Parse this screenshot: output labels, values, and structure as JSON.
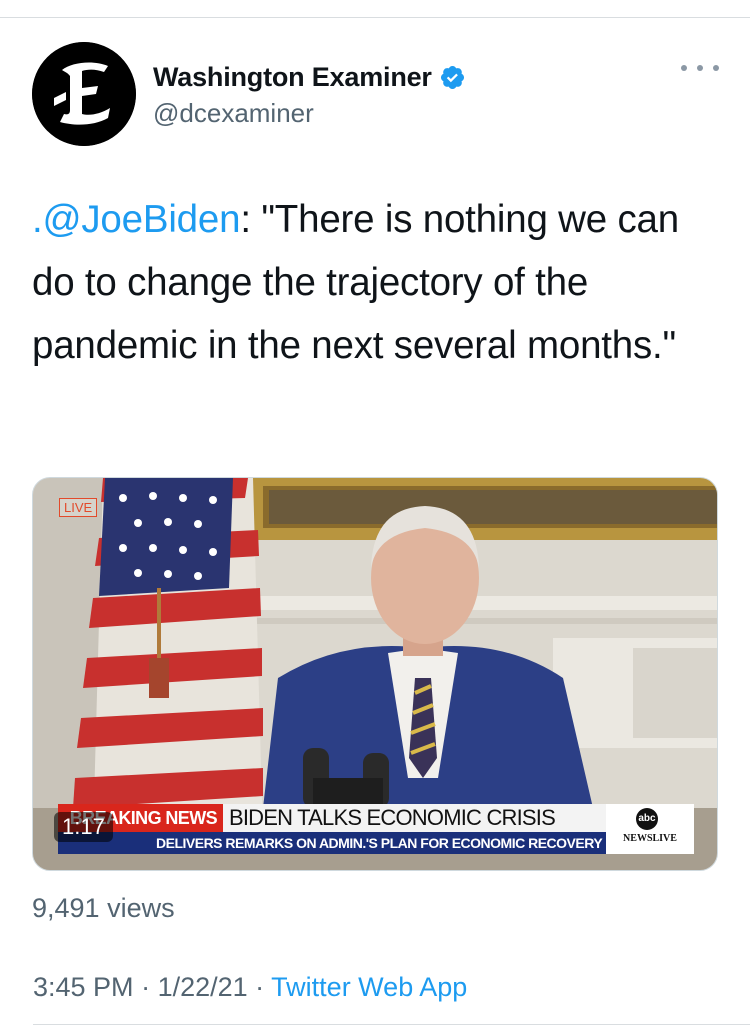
{
  "tweet": {
    "display_name": "Washington Examiner",
    "handle": "@dcexaminer",
    "verified": true,
    "avatar_icon": "washington-examiner-logo",
    "mention": ".@JoeBiden",
    "body_text": ": \"There is nothing we can do to change the trajectory of the pandemic in the next several months.\"",
    "views": "9,491 views",
    "time": "3:45 PM",
    "separator": " · ",
    "date": "1/22/21",
    "source_app": "Twitter Web App"
  },
  "video": {
    "live_label": "LIVE",
    "breaking_news": "BREAKING NEWS",
    "headline": "BIDEN TALKS ECONOMIC CRISIS",
    "subheadline": "DELIVERS REMARKS ON ADMIN.'S PLAN FOR ECONOMIC RECOVERY",
    "network_logo": "abc",
    "network_text": "NEWSLIVE",
    "duration": "1:17"
  },
  "colors": {
    "link": "#1d9bf0",
    "secondary_text": "#536471",
    "verified": "#1d9bf0",
    "breaking_red": "#d9261c",
    "chyron_blue": "#1a2f7a"
  }
}
